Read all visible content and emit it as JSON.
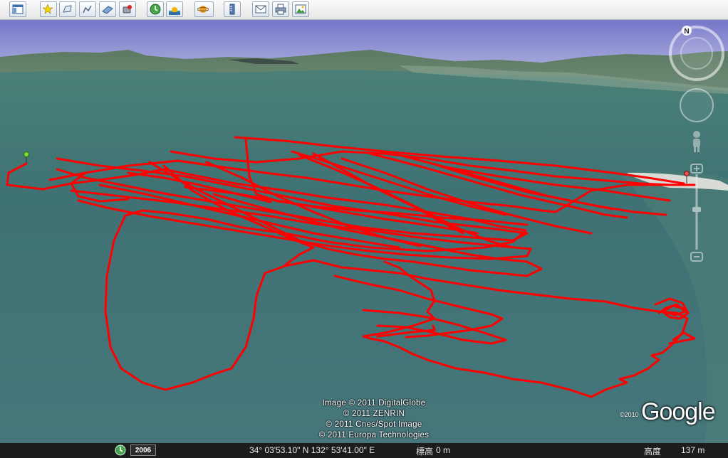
{
  "toolbar": {
    "buttons": [
      {
        "name": "sidebar-toggle-button",
        "icon": "sidebar-icon"
      },
      {
        "name": "add-placemark-button",
        "icon": "placemark-icon"
      },
      {
        "name": "add-polygon-button",
        "icon": "polygon-icon"
      },
      {
        "name": "add-path-button",
        "icon": "path-icon"
      },
      {
        "name": "add-image-overlay-button",
        "icon": "image-overlay-icon"
      },
      {
        "name": "record-tour-button",
        "icon": "record-tour-icon"
      },
      {
        "name": "historical-imagery-button",
        "icon": "clock-icon"
      },
      {
        "name": "sunlight-button",
        "icon": "sun-icon"
      },
      {
        "name": "switch-planet-button",
        "icon": "planet-icon"
      },
      {
        "name": "ruler-button",
        "icon": "ruler-icon"
      },
      {
        "name": "email-button",
        "icon": "email-icon"
      },
      {
        "name": "print-button",
        "icon": "print-icon"
      },
      {
        "name": "save-image-button",
        "icon": "save-image-icon"
      }
    ]
  },
  "attribution": {
    "lines": [
      "Image © 2011 DigitalGlobe",
      "© 2011 ZENRIN",
      "© 2011 Cnes/Spot Image",
      "© 2011 Europa Technologies"
    ]
  },
  "logo": {
    "year": "©2010",
    "text": "Google"
  },
  "status": {
    "imagery_year": "2006",
    "coordinates": "34° 03'53.10\" N 132° 53'41.00\" E",
    "elevation_label": "標高",
    "elevation_value": "0 m",
    "altitude_label": "高度",
    "altitude_value": "137 m"
  },
  "colors": {
    "track": "#ff0000",
    "sea": "#3f7172",
    "sky": "#8d8fd2",
    "start_pin": "#7fdc3a",
    "end_pin": "#e05050"
  },
  "icons": {
    "start": "green-pushpin-icon",
    "end": "red-pushpin-icon",
    "north": "north-indicator-icon"
  },
  "compass_label": "N"
}
